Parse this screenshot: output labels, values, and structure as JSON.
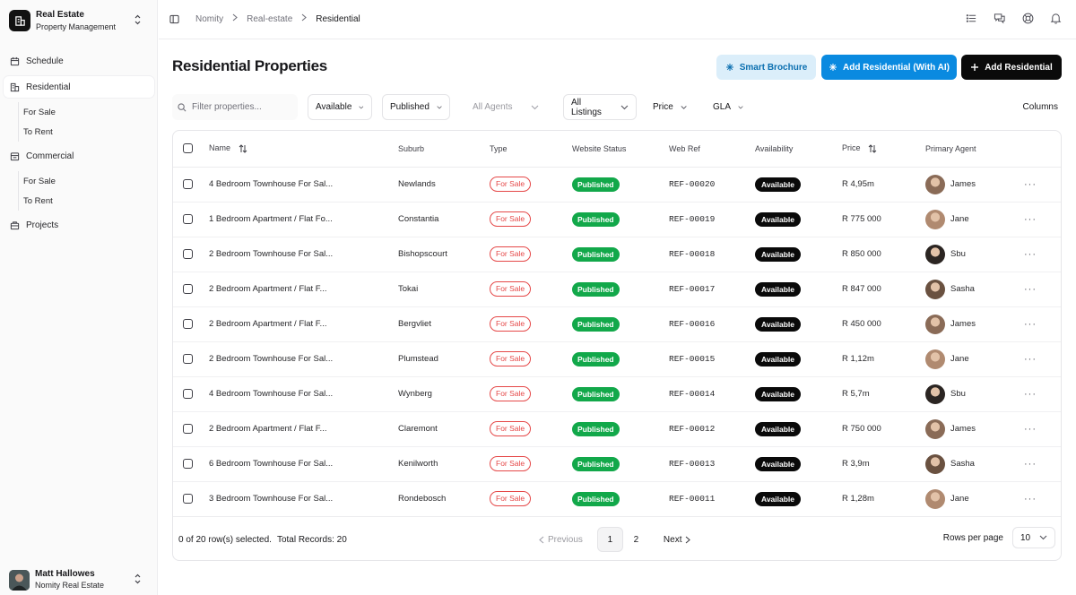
{
  "org": {
    "name": "Real Estate",
    "subtitle": "Property Management"
  },
  "sidebar": {
    "items": [
      {
        "label": "Schedule",
        "icon": "calendar-icon"
      },
      {
        "label": "Residential",
        "icon": "building-icon",
        "active": true,
        "children": [
          "For Sale",
          "To Rent"
        ]
      },
      {
        "label": "Commercial",
        "icon": "store-icon",
        "children": [
          "For Sale",
          "To Rent"
        ]
      },
      {
        "label": "Projects",
        "icon": "briefcase-icon"
      }
    ]
  },
  "user": {
    "name": "Matt Hallowes",
    "org": "Nomity Real Estate"
  },
  "breadcrumb": [
    "Nomity",
    "Real-estate",
    "Residential"
  ],
  "page": {
    "title": "Residential Properties",
    "smart_brochure": "Smart Brochure",
    "add_ai": "Add Residential (With AI)",
    "add": "Add Residential"
  },
  "filters": {
    "search_placeholder": "Filter properties...",
    "availability": "Available",
    "status": "Published",
    "agents": "All Agents",
    "listings": "All Listings",
    "price": "Price",
    "gla": "GLA",
    "columns": "Columns"
  },
  "table": {
    "headers": [
      "Name",
      "Suburb",
      "Type",
      "Website Status",
      "Web Ref",
      "Availability",
      "Price",
      "Primary Agent"
    ],
    "rows": [
      {
        "name": "4 Bedroom Townhouse For Sal...",
        "suburb": "Newlands",
        "type": "For Sale",
        "status": "Published",
        "ref": "REF-00020",
        "availability": "Available",
        "price": "R 4,95m",
        "agent": "James",
        "avatar": "#8a6b57"
      },
      {
        "name": "1 Bedroom Apartment / Flat Fo...",
        "suburb": "Constantia",
        "type": "For Sale",
        "status": "Published",
        "ref": "REF-00019",
        "availability": "Available",
        "price": "R 775 000",
        "agent": "Jane",
        "avatar": "#b08a70"
      },
      {
        "name": "2 Bedroom Townhouse For Sal...",
        "suburb": "Bishopscourt",
        "type": "For Sale",
        "status": "Published",
        "ref": "REF-00018",
        "availability": "Available",
        "price": "R 850 000",
        "agent": "Sbu",
        "avatar": "#2b2522"
      },
      {
        "name": "2 Bedroom Apartment / Flat F...",
        "suburb": "Tokai",
        "type": "For Sale",
        "status": "Published",
        "ref": "REF-00017",
        "availability": "Available",
        "price": "R 847 000",
        "agent": "Sasha",
        "avatar": "#6a5140"
      },
      {
        "name": "2 Bedroom Apartment / Flat F...",
        "suburb": "Bergvliet",
        "type": "For Sale",
        "status": "Published",
        "ref": "REF-00016",
        "availability": "Available",
        "price": "R 450 000",
        "agent": "James",
        "avatar": "#8a6b57"
      },
      {
        "name": "2 Bedroom Townhouse For Sal...",
        "suburb": "Plumstead",
        "type": "For Sale",
        "status": "Published",
        "ref": "REF-00015",
        "availability": "Available",
        "price": "R 1,12m",
        "agent": "Jane",
        "avatar": "#b08a70"
      },
      {
        "name": "4 Bedroom Townhouse For Sal...",
        "suburb": "Wynberg",
        "type": "For Sale",
        "status": "Published",
        "ref": "REF-00014",
        "availability": "Available",
        "price": "R 5,7m",
        "agent": "Sbu",
        "avatar": "#2b2522"
      },
      {
        "name": "2 Bedroom Apartment / Flat F...",
        "suburb": "Claremont",
        "type": "For Sale",
        "status": "Published",
        "ref": "REF-00012",
        "availability": "Available",
        "price": "R 750 000",
        "agent": "James",
        "avatar": "#8a6b57"
      },
      {
        "name": "6 Bedroom Townhouse For Sal...",
        "suburb": "Kenilworth",
        "type": "For Sale",
        "status": "Published",
        "ref": "REF-00013",
        "availability": "Available",
        "price": "R 3,9m",
        "agent": "Sasha",
        "avatar": "#6a5140"
      },
      {
        "name": "3 Bedroom Townhouse For Sal...",
        "suburb": "Rondebosch",
        "type": "For Sale",
        "status": "Published",
        "ref": "REF-00011",
        "availability": "Available",
        "price": "R 1,28m",
        "agent": "Jane",
        "avatar": "#b08a70"
      }
    ]
  },
  "footer": {
    "selected": "0 of 20 row(s) selected.",
    "total": "Total Records: 20",
    "previous": "Previous",
    "pages": [
      "1",
      "2"
    ],
    "next": "Next",
    "rows_label": "Rows per page",
    "rows_value": "10"
  },
  "colors": {
    "accent": "#0a8ae0",
    "published": "#12a84a",
    "sale": "#e54848"
  }
}
